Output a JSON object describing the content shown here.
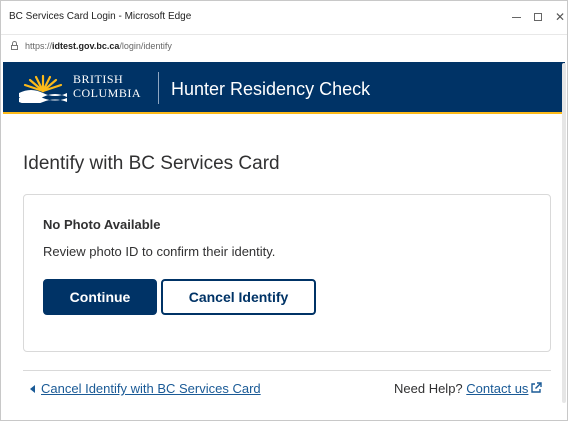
{
  "window": {
    "title": "BC Services Card Login - Microsoft Edge",
    "minimize": "–",
    "close": "✕"
  },
  "address": {
    "prefix": "https://",
    "host": "idtest.gov.bc.ca",
    "path": "/login/identify"
  },
  "header": {
    "logo_line1": "BRITISH",
    "logo_line2": "COLUMBIA",
    "app_title": "Hunter Residency Check",
    "bg_color": "#003366",
    "accent_color": "#fcba19"
  },
  "main": {
    "page_title": "Identify with BC Services Card",
    "card": {
      "heading": "No Photo Available",
      "text": "Review photo ID to confirm their identity.",
      "continue_label": "Continue",
      "cancel_label": "Cancel Identify"
    }
  },
  "footer": {
    "back_link": "Cancel Identify with BC Services Card",
    "help_text": "Need Help? ",
    "contact_link": "Contact us"
  },
  "icons": {
    "lock": "lock-icon",
    "external": "external-link-icon",
    "back": "chevron-left-icon"
  }
}
